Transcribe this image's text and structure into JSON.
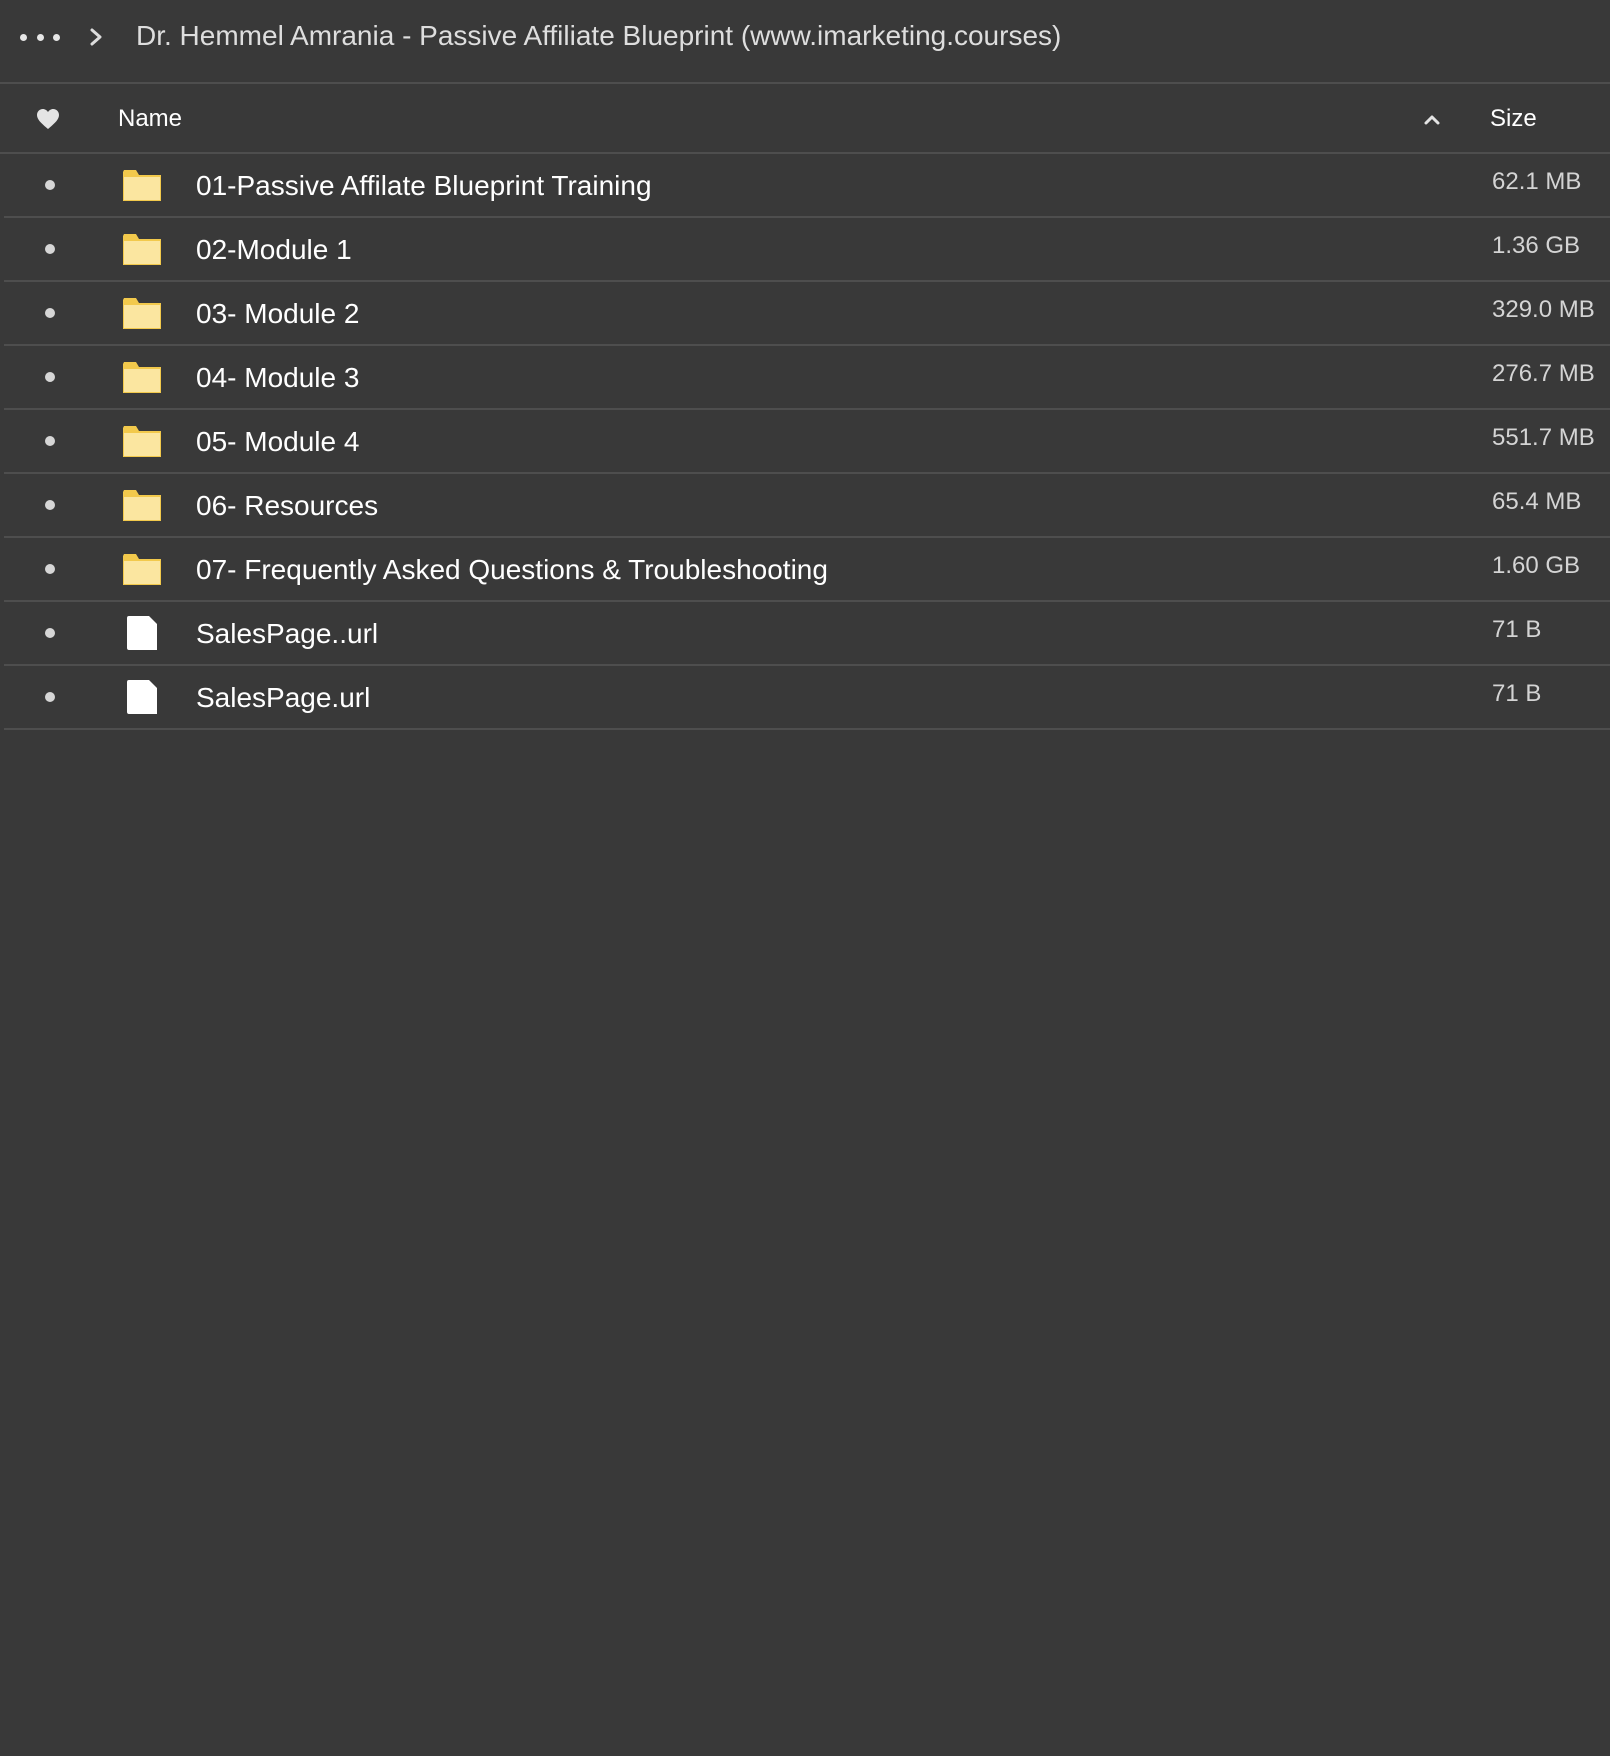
{
  "breadcrumb": {
    "more_icon": "ellipsis-icon",
    "separator_icon": "chevron-right-icon",
    "current_folder": "Dr. Hemmel Amrania - Passive Affiliate Blueprint (www.imarketing.courses)"
  },
  "table": {
    "favorite_icon": "heart-icon",
    "columns": {
      "name": "Name",
      "size": "Size",
      "sort_icon": "chevron-up-icon"
    },
    "rows": [
      {
        "type": "folder",
        "name": "01-Passive Affilate Blueprint Training",
        "size": "62.1 MB"
      },
      {
        "type": "folder",
        "name": "02-Module 1",
        "size": "1.36 GB"
      },
      {
        "type": "folder",
        "name": "03- Module 2",
        "size": "329.0 MB"
      },
      {
        "type": "folder",
        "name": "04- Module 3",
        "size": "276.7 MB"
      },
      {
        "type": "folder",
        "name": "05- Module 4",
        "size": "551.7 MB"
      },
      {
        "type": "folder",
        "name": "06- Resources",
        "size": "65.4 MB"
      },
      {
        "type": "folder",
        "name": "07- Frequently Asked Questions & Troubleshooting",
        "size": "1.60 GB"
      },
      {
        "type": "file",
        "name": "SalesPage..url",
        "size": "71 B"
      },
      {
        "type": "file",
        "name": "SalesPage.url",
        "size": "71 B"
      }
    ]
  },
  "colors": {
    "background": "#393939",
    "divider": "#4e4e4e",
    "folder_fill": "#fbe6a0",
    "folder_tab": "#f2c94c",
    "file_fill": "#ffffff"
  }
}
